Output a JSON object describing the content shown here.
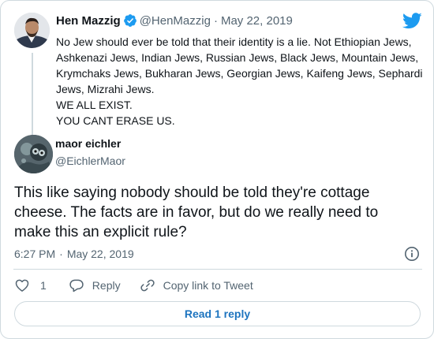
{
  "parent_tweet": {
    "author_name": "Hen Mazzig",
    "verified_icon": "verified-badge-icon",
    "handle": "@HenMazzig",
    "date_separator": "·",
    "date": "May 22, 2019",
    "body_lines": [
      "No Jew should ever be told that their identity is a lie. Not Ethiopian Jews, Ashkenazi Jews, Indian Jews, Russian Jews, Black Jews, Mountain Jews, Krymchaks Jews, Bukharan Jews, Georgian Jews, Kaifeng Jews, Sephardi Jews, Mizrahi Jews.",
      "WE ALL EXIST.",
      "YOU CANT ERASE US."
    ]
  },
  "tweet": {
    "author_name": "maor eichler",
    "handle": "@EichlerMaor",
    "text": "This like saying nobody should be told they're cottage cheese. The facts are in favor, but do we really need to make this an explicit rule?",
    "time": "6:27 PM",
    "date_separator": "·",
    "date": "May 22, 2019"
  },
  "actions": {
    "like_count": "1",
    "reply_label": "Reply",
    "copy_link_label": "Copy link to Tweet"
  },
  "read_replies_label": "Read 1 reply",
  "colors": {
    "twitter_blue": "#1d9bf0",
    "link_blue": "#1d74bf",
    "muted_text": "#536471",
    "border": "#cfd9de"
  },
  "icons": [
    "twitter-logo-icon",
    "verified-badge-icon",
    "info-icon",
    "heart-icon",
    "reply-icon",
    "link-icon"
  ]
}
